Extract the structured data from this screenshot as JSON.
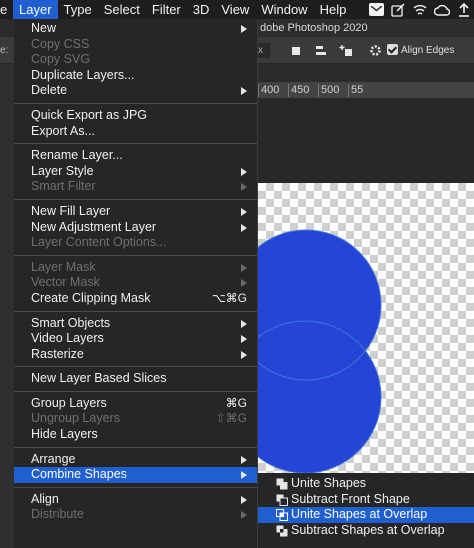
{
  "menubar": {
    "items": [
      {
        "label": "e",
        "active": false
      },
      {
        "label": "Layer",
        "active": true
      },
      {
        "label": "Type",
        "active": false
      },
      {
        "label": "Select",
        "active": false
      },
      {
        "label": "Filter",
        "active": false
      },
      {
        "label": "3D",
        "active": false
      },
      {
        "label": "View",
        "active": false
      },
      {
        "label": "Window",
        "active": false
      },
      {
        "label": "Help",
        "active": false
      }
    ],
    "tray_icons": [
      "mail-icon",
      "edit-icon",
      "cast-icon",
      "creative-cloud-icon",
      "upload-icon"
    ]
  },
  "app": {
    "title": "dobe Photoshop 2020",
    "options_bar": {
      "left_label": "e:",
      "field_value": "x",
      "align_edges_label": "Align Edges",
      "align_edges_checked": true
    },
    "ruler_ticks": [
      "400",
      "450",
      "500",
      "55"
    ]
  },
  "menu": {
    "items": [
      {
        "label": "New",
        "enabled": true,
        "submenu": true
      },
      {
        "label": "Copy CSS",
        "enabled": false
      },
      {
        "label": "Copy SVG",
        "enabled": false
      },
      {
        "label": "Duplicate Layers...",
        "enabled": true
      },
      {
        "label": "Delete",
        "enabled": true,
        "submenu": true
      },
      {
        "separator": true
      },
      {
        "label": "Quick Export as JPG",
        "enabled": true
      },
      {
        "label": "Export As...",
        "enabled": true
      },
      {
        "separator": true
      },
      {
        "label": "Rename Layer...",
        "enabled": true
      },
      {
        "label": "Layer Style",
        "enabled": true,
        "submenu": true
      },
      {
        "label": "Smart Filter",
        "enabled": false,
        "submenu": true
      },
      {
        "separator": true
      },
      {
        "label": "New Fill Layer",
        "enabled": true,
        "submenu": true
      },
      {
        "label": "New Adjustment Layer",
        "enabled": true,
        "submenu": true
      },
      {
        "label": "Layer Content Options...",
        "enabled": false
      },
      {
        "separator": true
      },
      {
        "label": "Layer Mask",
        "enabled": false,
        "submenu": true
      },
      {
        "label": "Vector Mask",
        "enabled": false,
        "submenu": true
      },
      {
        "label": "Create Clipping Mask",
        "enabled": true,
        "shortcut": "⌥⌘G"
      },
      {
        "separator": true
      },
      {
        "label": "Smart Objects",
        "enabled": true,
        "submenu": true
      },
      {
        "label": "Video Layers",
        "enabled": true,
        "submenu": true
      },
      {
        "label": "Rasterize",
        "enabled": true,
        "submenu": true
      },
      {
        "separator": true
      },
      {
        "label": "New Layer Based Slices",
        "enabled": true
      },
      {
        "separator": true
      },
      {
        "label": "Group Layers",
        "enabled": true,
        "shortcut": "⌘G"
      },
      {
        "label": "Ungroup Layers",
        "enabled": false,
        "shortcut": "⇧⌘G"
      },
      {
        "label": "Hide Layers",
        "enabled": true
      },
      {
        "separator": true
      },
      {
        "label": "Arrange",
        "enabled": true,
        "submenu": true
      },
      {
        "label": "Combine Shapes",
        "enabled": true,
        "submenu": true,
        "selected": true
      },
      {
        "separator": true
      },
      {
        "label": "Align",
        "enabled": true,
        "submenu": true
      },
      {
        "label": "Distribute",
        "enabled": false,
        "submenu": true
      }
    ]
  },
  "submenu": {
    "items": [
      {
        "label": "Unite Shapes",
        "icon": "unite-shapes-icon",
        "selected": false
      },
      {
        "label": "Subtract Front Shape",
        "icon": "subtract-front-shape-icon",
        "selected": false
      },
      {
        "label": "Unite Shapes at Overlap",
        "icon": "intersect-shapes-icon",
        "selected": true
      },
      {
        "label": "Subtract Shapes at Overlap",
        "icon": "exclude-overlap-icon",
        "selected": false
      }
    ]
  },
  "colors": {
    "menu_bg": "#262626",
    "selection": "#1f5fd0",
    "shape_fill": "#2445d6",
    "disabled_text": "#6f6f6f"
  }
}
